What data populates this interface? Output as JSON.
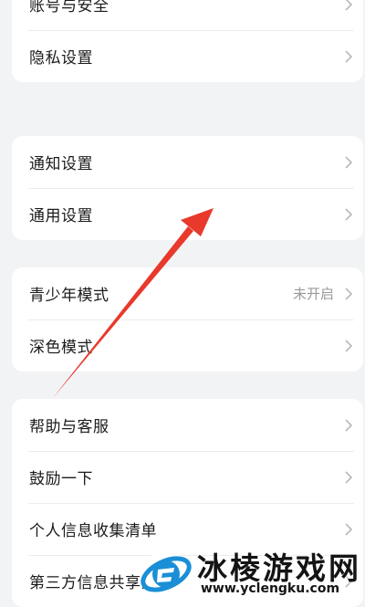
{
  "settings": {
    "group1": [
      {
        "label": "账号与安全"
      },
      {
        "label": "隐私设置"
      }
    ],
    "group2": [
      {
        "label": "通知设置"
      },
      {
        "label": "通用设置"
      }
    ],
    "group3": [
      {
        "label": "青少年模式",
        "value": "未开启"
      },
      {
        "label": "深色模式"
      }
    ],
    "group4": [
      {
        "label": "帮助与客服"
      },
      {
        "label": "鼓励一下"
      },
      {
        "label": "个人信息收集清单"
      },
      {
        "label": "第三方信息共享清单"
      }
    ]
  },
  "annotation": {
    "arrow_color": "#e8392c"
  },
  "watermark": {
    "title": "冰棱游戏网",
    "url": "www.yclengku.com"
  }
}
